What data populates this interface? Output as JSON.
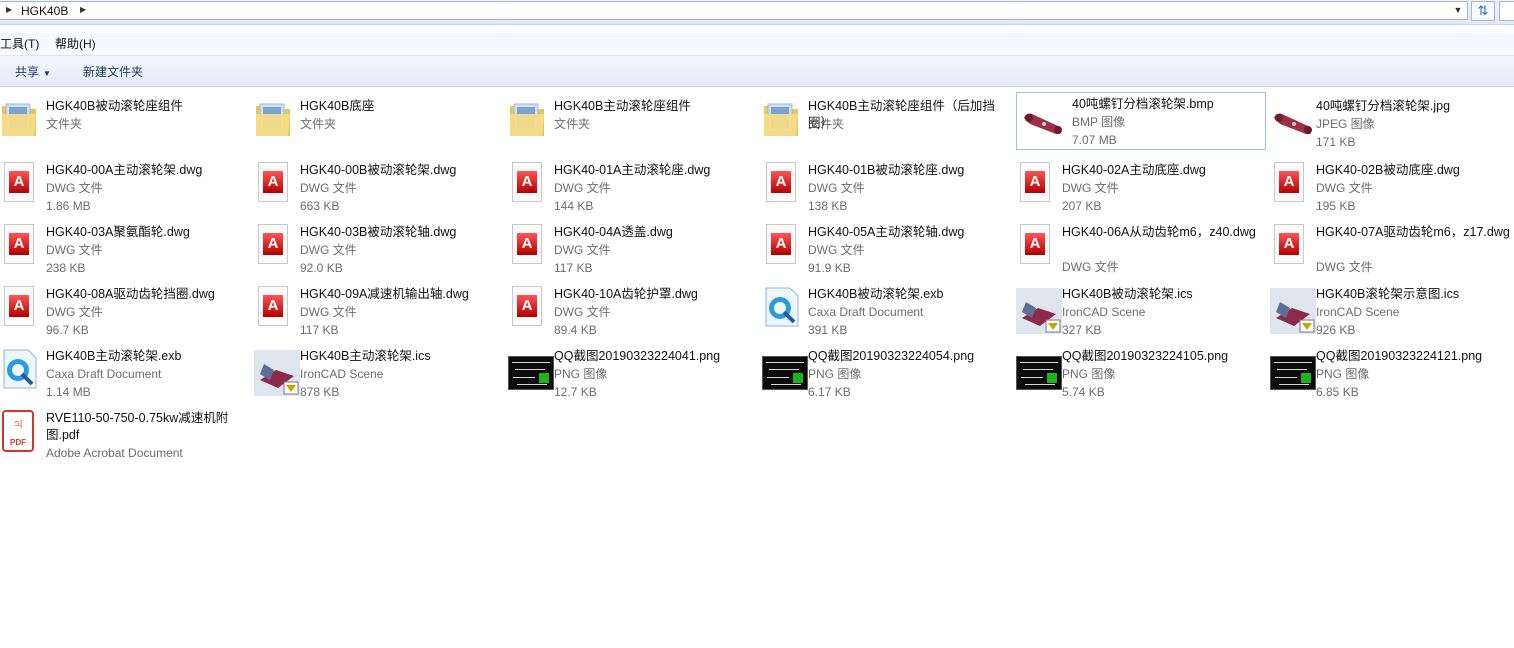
{
  "address": {
    "segment": "HGK40B"
  },
  "menu": {
    "tools": "工具(T)",
    "help": "帮助(H)"
  },
  "toolbar": {
    "share": "共享",
    "new_folder": "新建文件夹"
  },
  "items": [
    {
      "name": "HGK40B被动滚轮座组件",
      "type": "文件夹",
      "size": "",
      "icon": "folder-icon"
    },
    {
      "name": "HGK40B底座",
      "type": "文件夹",
      "size": "",
      "icon": "folder-icon"
    },
    {
      "name": "HGK40B主动滚轮座组件",
      "type": "文件夹",
      "size": "",
      "icon": "folder-icon"
    },
    {
      "name": "HGK40B主动滚轮座组件（后加挡圈）",
      "type": "文件夹",
      "size": "",
      "icon": "folder-icon"
    },
    {
      "name": "40吨螺钉分档滚轮架.bmp",
      "type": "BMP 图像",
      "size": "7.07 MB",
      "icon": "part-thumbnail-icon",
      "selected": true
    },
    {
      "name": "40吨螺钉分档滚轮架.jpg",
      "type": "JPEG 图像",
      "size": "171 KB",
      "icon": "part-thumbnail-icon"
    },
    {
      "name": "HGK40-00A主动滚轮架.dwg",
      "type": "DWG 文件",
      "size": "1.86 MB",
      "icon": "dwg-file-icon"
    },
    {
      "name": "HGK40-00B被动滚轮架.dwg",
      "type": "DWG 文件",
      "size": "663 KB",
      "icon": "dwg-file-icon"
    },
    {
      "name": "HGK40-01A主动滚轮座.dwg",
      "type": "DWG 文件",
      "size": "144 KB",
      "icon": "dwg-file-icon"
    },
    {
      "name": "HGK40-01B被动滚轮座.dwg",
      "type": "DWG 文件",
      "size": "138 KB",
      "icon": "dwg-file-icon"
    },
    {
      "name": "HGK40-02A主动底座.dwg",
      "type": "DWG 文件",
      "size": "207 KB",
      "icon": "dwg-file-icon"
    },
    {
      "name": "HGK40-02B被动底座.dwg",
      "type": "DWG 文件",
      "size": "195 KB",
      "icon": "dwg-file-icon"
    },
    {
      "name": "HGK40-03A聚氨酯轮.dwg",
      "type": "DWG 文件",
      "size": "238 KB",
      "icon": "dwg-file-icon"
    },
    {
      "name": "HGK40-03B被动滚轮轴.dwg",
      "type": "DWG 文件",
      "size": "92.0 KB",
      "icon": "dwg-file-icon"
    },
    {
      "name": "HGK40-04A透盖.dwg",
      "type": "DWG 文件",
      "size": "117 KB",
      "icon": "dwg-file-icon"
    },
    {
      "name": "HGK40-05A主动滚轮轴.dwg",
      "type": "DWG 文件",
      "size": "91.9 KB",
      "icon": "dwg-file-icon"
    },
    {
      "name": "HGK40-06A从动齿轮m6，z40.dwg",
      "type": "DWG 文件",
      "size": "",
      "icon": "dwg-file-icon"
    },
    {
      "name": "HGK40-07A驱动齿轮m6，z17.dwg",
      "type": "DWG 文件",
      "size": "",
      "icon": "dwg-file-icon"
    },
    {
      "name": "HGK40-08A驱动齿轮挡圈.dwg",
      "type": "DWG 文件",
      "size": "96.7 KB",
      "icon": "dwg-file-icon"
    },
    {
      "name": "HGK40-09A减速机输出轴.dwg",
      "type": "DWG 文件",
      "size": "117 KB",
      "icon": "dwg-file-icon"
    },
    {
      "name": "HGK40-10A齿轮护罩.dwg",
      "type": "DWG 文件",
      "size": "89.4 KB",
      "icon": "dwg-file-icon"
    },
    {
      "name": "HGK40B被动滚轮架.exb",
      "type": "Caxa Draft Document",
      "size": "391 KB",
      "icon": "caxa-file-icon"
    },
    {
      "name": "HGK40B被动滚轮架.ics",
      "type": "IronCAD Scene",
      "size": "327 KB",
      "icon": "ironcad-scene-icon"
    },
    {
      "name": "HGK40B滚轮架示意图.ics",
      "type": "IronCAD Scene",
      "size": "926 KB",
      "icon": "ironcad-scene-icon"
    },
    {
      "name": "HGK40B主动滚轮架.exb",
      "type": "Caxa Draft Document",
      "size": "1.14 MB",
      "icon": "caxa-file-icon"
    },
    {
      "name": "HGK40B主动滚轮架.ics",
      "type": "IronCAD Scene",
      "size": "878 KB",
      "icon": "ironcad-scene-icon"
    },
    {
      "name": "QQ截图20190323224041.png",
      "type": "PNG 图像",
      "size": "12.7 KB",
      "icon": "screenshot-thumbnail-icon"
    },
    {
      "name": "QQ截图20190323224054.png",
      "type": "PNG 图像",
      "size": "6.17 KB",
      "icon": "screenshot-thumbnail-icon"
    },
    {
      "name": "QQ截图20190323224105.png",
      "type": "PNG 图像",
      "size": "5.74 KB",
      "icon": "screenshot-thumbnail-icon"
    },
    {
      "name": "QQ截图20190323224121.png",
      "type": "PNG 图像",
      "size": "6.85 KB",
      "icon": "screenshot-thumbnail-icon"
    },
    {
      "name": "RVE110-50-750-0.75kw减速机附图.pdf",
      "type": "Adobe Acrobat Document",
      "size": "",
      "icon": "pdf-file-icon"
    }
  ]
}
